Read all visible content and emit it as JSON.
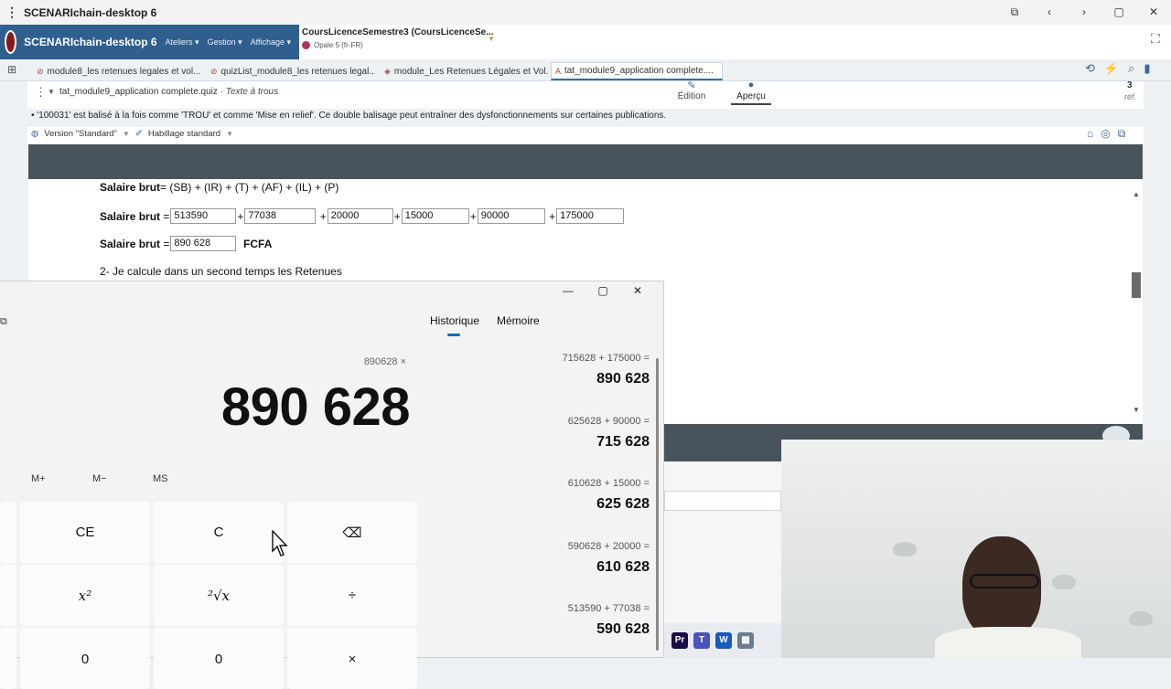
{
  "window": {
    "title": "SCENARIchain-desktop 6",
    "controls": [
      "⧉",
      "‹",
      "›",
      "▢",
      "✕"
    ]
  },
  "app": {
    "brand": "SCENARIchain-desktop 6",
    "menus": [
      "Ateliers ▾",
      "Gestion ▾",
      "Affichage ▾"
    ],
    "workshop_title": "CoursLicenceSemestre3 (CoursLicenceSe...",
    "workshop_sub": "Opale 5 (fr-FR)"
  },
  "tabs": [
    {
      "label": "module8_les retenues legales et vol..."
    },
    {
      "label": "quizList_module8_les retenues legal..."
    },
    {
      "label": "module_Les Retenues Légales et Vol..."
    },
    {
      "label": "tat_module9_application complete...."
    }
  ],
  "doc": {
    "name": "tat_module9_application complete.quiz",
    "type": "Texte à trous",
    "mode_edit": "Édition",
    "mode_preview": "Aperçu",
    "ref_count": "3",
    "ref_label": "réf.",
    "warning": "• '100031' est balisé à la fois comme 'TROU' et comme 'Mise en relief'. Ce double balisage peut entraîner des dysfonctionnements sur certaines publications.",
    "version": "Version \"Standard\"",
    "skin": "Habillage standard"
  },
  "preview": {
    "line0_label": "Salaire brut",
    "line0_formula": " = (SB) + (IR) + (T) + (AF) + (IL) + (P)",
    "line1_label": "Salaire brut",
    "line1_fields": [
      "513590",
      "77038",
      "20000",
      "15000",
      "90000",
      "175000"
    ],
    "line2_label": "Salaire brut",
    "line2_value": "890 628",
    "line2_unit": "FCFA",
    "line3": "2- Je calcule dans un second temps les Retenues"
  },
  "calculator": {
    "controls": [
      "—",
      "▢",
      "✕"
    ],
    "tab_history": "Historique",
    "tab_memory": "Mémoire",
    "expression": "890628 ×",
    "display": "890 628",
    "memory_keys": [
      "M+",
      "M−",
      "MS"
    ],
    "keys_row1": [
      "CE",
      "C",
      "⌫"
    ],
    "keys_row2": [
      "x²",
      "²√x",
      "÷"
    ],
    "keys_row3": [
      "0",
      "0",
      "×"
    ],
    "history": [
      {
        "expr": "715628   +   175000 =",
        "result": "890 628"
      },
      {
        "expr": "625628   +   90000 =",
        "result": "715 628"
      },
      {
        "expr": "610628   +   15000 =",
        "result": "625 628"
      },
      {
        "expr": "590628   +   20000 =",
        "result": "610 628"
      },
      {
        "expr": "513590   +   77038 =",
        "result": "590 628"
      }
    ]
  },
  "taskbar": {
    "apps": [
      {
        "icon": "premiere-icon",
        "letter": "Pr",
        "color": "#1a0a4a"
      },
      {
        "icon": "teams-icon",
        "letter": "T",
        "color": "#4b53bc"
      },
      {
        "icon": "word-icon",
        "letter": "W",
        "color": "#185abd"
      },
      {
        "icon": "calculator-icon",
        "letter": "▦",
        "color": "#6a7d8f"
      }
    ]
  }
}
